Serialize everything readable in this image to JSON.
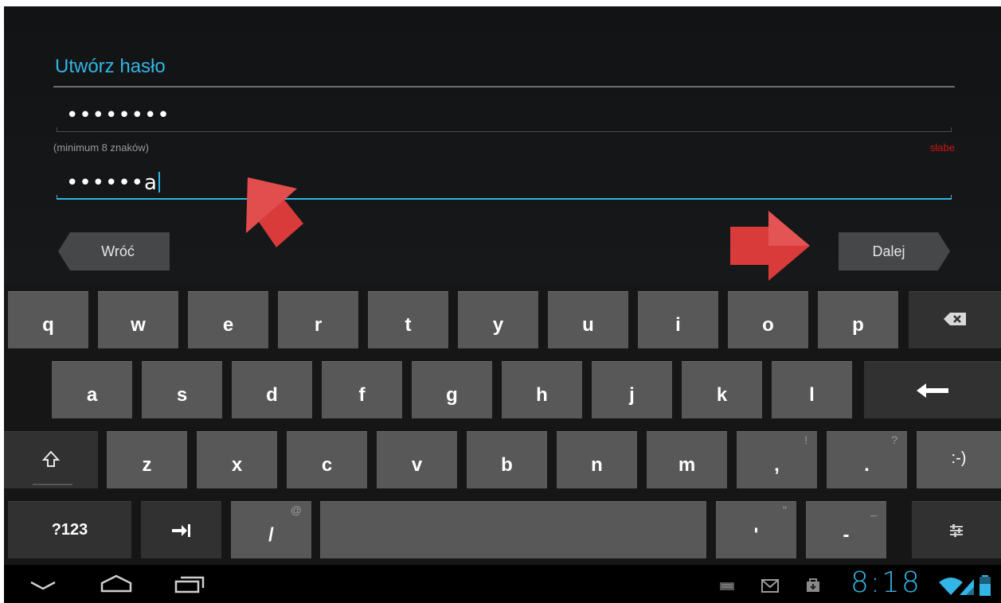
{
  "form": {
    "title": "Utwórz hasło",
    "password_value": "••••••••",
    "confirm_value": "••••••a",
    "hint": "(minimum 8 znaków)",
    "strength": "słabe",
    "back_label": "Wróć",
    "next_label": "Dalej"
  },
  "keyboard": {
    "row1": [
      "q",
      "w",
      "e",
      "r",
      "t",
      "y",
      "u",
      "i",
      "o",
      "p"
    ],
    "row2": [
      "a",
      "s",
      "d",
      "f",
      "g",
      "h",
      "j",
      "k",
      "l"
    ],
    "row3": [
      "z",
      "x",
      "c",
      "v",
      "b",
      "n",
      "m"
    ],
    "comma": ",",
    "comma_sub": "!",
    "period": ".",
    "period_sub": "?",
    "smiley": ":-)",
    "symbols": "?123",
    "slash": "/",
    "slash_sub": "@",
    "apostrophe": "'",
    "apostrophe_sub": "\"",
    "dash": "-",
    "dash_sub": "_"
  },
  "status_bar": {
    "time": "8:18"
  },
  "icons": {
    "backspace": "backspace-icon",
    "enter": "enter-icon",
    "shift": "shift-icon",
    "tab": "tab-icon",
    "settings": "keyboard-settings-icon",
    "nav_back": "nav-back-icon",
    "nav_home": "nav-home-icon",
    "nav_recents": "nav-recents-icon",
    "keyboard_notif": "keyboard-notification-icon",
    "gmail": "gmail-icon",
    "store": "store-icon",
    "wifi": "wifi-icon",
    "signal": "signal-icon",
    "battery": "battery-icon"
  },
  "colors": {
    "accent": "#33b5e5",
    "weak": "#d01616",
    "arrow": "#d93a3a"
  }
}
